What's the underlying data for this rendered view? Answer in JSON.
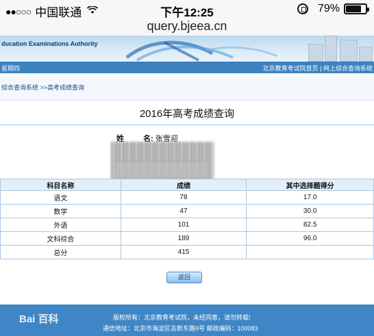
{
  "status_bar": {
    "carrier": "中国联通",
    "time": "下午12:25",
    "battery_percent": "79%",
    "battery_level": 0.79,
    "signal_icon": "signal-dots-icon",
    "wifi_icon": "wifi-icon",
    "lock_icon": "orientation-lock-icon"
  },
  "url": "query.bjeea.cn",
  "banner": {
    "text": "ducation Examinations Authority"
  },
  "nav": {
    "left": "星期四",
    "right": "北京教育考试院首页 | 网上综合查询系统"
  },
  "breadcrumb": "综合查询系统 >>高考成绩查询",
  "page_title": "2016年高考成绩查询",
  "student": {
    "name_label_1": "姓",
    "name_label_2": "名:",
    "name_value": "张雪迎"
  },
  "table": {
    "headers": [
      "科目名称",
      "成绩",
      "其中选择题得分"
    ],
    "rows": [
      [
        "语文",
        "78",
        "17.0"
      ],
      [
        "数学",
        "47",
        "30.0"
      ],
      [
        "外语",
        "101",
        "82.5"
      ],
      [
        "文科综合",
        "189",
        "96.0"
      ],
      [
        "总分",
        "415",
        ""
      ]
    ]
  },
  "back_button": "返回",
  "footer": {
    "line1": "版权所有：北京教育考试院，未经同意，请勿转载!",
    "line2": "通信地址：北京市海淀区志新东路9号 邮政编码：100083",
    "watermark": "Bai 百科"
  },
  "colors": {
    "nav_bar": "#3c82bf",
    "footer": "#3f86c6",
    "table_header": "#e3eef8",
    "border": "#a9c7e0"
  }
}
